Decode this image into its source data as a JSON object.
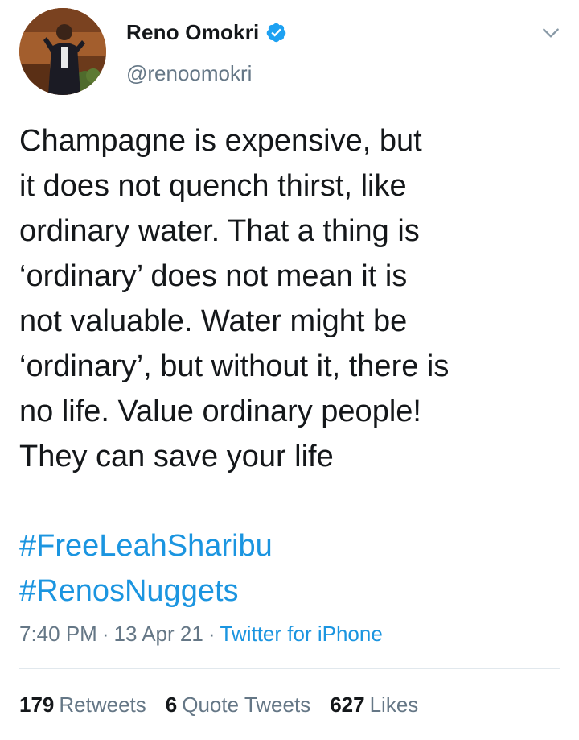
{
  "user": {
    "display_name": "Reno Omokri",
    "handle": "@renoomokri",
    "verified_icon": "verified-badge-icon",
    "avatar_icon": "profile-photo"
  },
  "menu_icon": "chevron-down-icon",
  "tweet": {
    "text": "Champagne is expensive, but\nit does not quench thirst, like\nordinary water. That a thing is\n‘ordinary’ does not mean it is\nnot valuable. Water might be\n‘ordinary’, but without it, there is\nno life. Value ordinary people!\nThey can save your life",
    "hashtags": [
      "#FreeLeahSharibu",
      "#RenosNuggets"
    ],
    "time": "7:40 PM",
    "separator": "·",
    "date": "13 Apr 21",
    "source": "Twitter for iPhone"
  },
  "stats": [
    {
      "count": "179",
      "label": "Retweets"
    },
    {
      "count": "6",
      "label": "Quote Tweets"
    },
    {
      "count": "627",
      "label": "Likes"
    }
  ],
  "colors": {
    "link": "#1b95e0",
    "secondary_text": "#657786",
    "primary_text": "#14171a",
    "divider": "#e1e8ed"
  }
}
